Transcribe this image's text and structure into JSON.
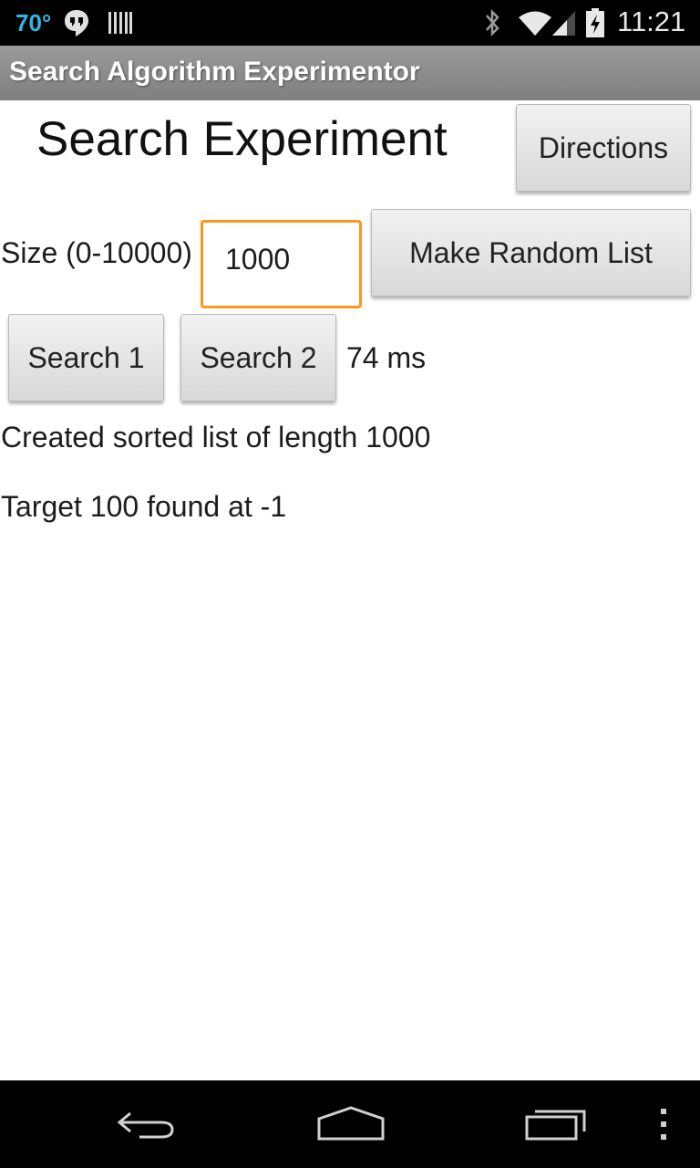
{
  "status_bar": {
    "temperature": "70°",
    "time": "11:21",
    "icons": [
      "hangouts-icon",
      "barcode-icon",
      "bluetooth-icon",
      "wifi-icon",
      "signal-icon",
      "battery-charging-icon"
    ]
  },
  "app": {
    "title": "Search Algorithm Experimentor"
  },
  "main": {
    "heading": "Search Experiment",
    "directions_label": "Directions",
    "size_label": "Size (0-10000)",
    "size_value": "1000",
    "make_random_label": "Make Random List",
    "search1_label": "Search 1",
    "search2_label": "Search 2",
    "time_result": "74 ms",
    "status_list": "Created sorted list of length 1000",
    "status_target": "Target 100 found at -1"
  },
  "nav_bar": {
    "icons": [
      "back-icon",
      "home-icon",
      "recent-apps-icon",
      "overflow-menu-icon"
    ]
  },
  "colors": {
    "accent_focus": "#ff9519",
    "status_temp": "#33b5e5",
    "title_bar": "#8c8c8c"
  }
}
